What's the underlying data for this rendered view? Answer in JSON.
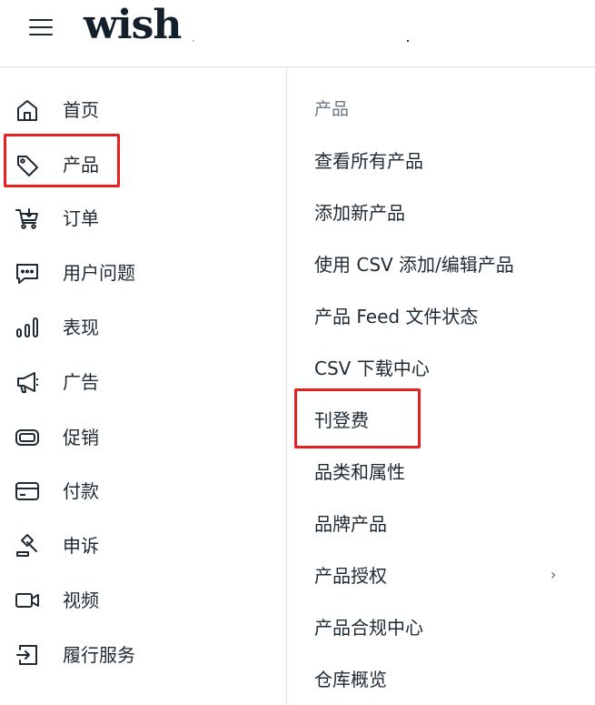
{
  "header": {
    "logo_text": "wish"
  },
  "sidebar": {
    "items": [
      {
        "label": "首页",
        "icon": "home-icon"
      },
      {
        "label": "产品",
        "icon": "tag-icon",
        "highlighted": true
      },
      {
        "label": "订单",
        "icon": "cart-icon"
      },
      {
        "label": "用户问题",
        "icon": "chat-icon"
      },
      {
        "label": "表现",
        "icon": "bar-chart-icon"
      },
      {
        "label": "广告",
        "icon": "megaphone-icon"
      },
      {
        "label": "促销",
        "icon": "promo-icon"
      },
      {
        "label": "付款",
        "icon": "credit-card-icon"
      },
      {
        "label": "申诉",
        "icon": "gavel-icon"
      },
      {
        "label": "视频",
        "icon": "video-icon"
      },
      {
        "label": "履行服务",
        "icon": "fulfillment-icon"
      }
    ]
  },
  "submenu": {
    "title": "产品",
    "items": [
      {
        "label": "查看所有产品"
      },
      {
        "label": "添加新产品"
      },
      {
        "label": "使用 CSV 添加/编辑产品"
      },
      {
        "label": "产品 Feed 文件状态"
      },
      {
        "label": "CSV 下载中心"
      },
      {
        "label": "刊登费",
        "highlighted": true
      },
      {
        "label": "品类和属性"
      },
      {
        "label": "品牌产品"
      },
      {
        "label": "产品授权",
        "has_submenu": true
      },
      {
        "label": "产品合规中心"
      },
      {
        "label": "仓库概览"
      }
    ],
    "chevron": "›"
  },
  "colors": {
    "highlight": "#e8201f",
    "text": "#1f2a33",
    "muted": "#6b7782",
    "divider": "#dfe3e6"
  }
}
